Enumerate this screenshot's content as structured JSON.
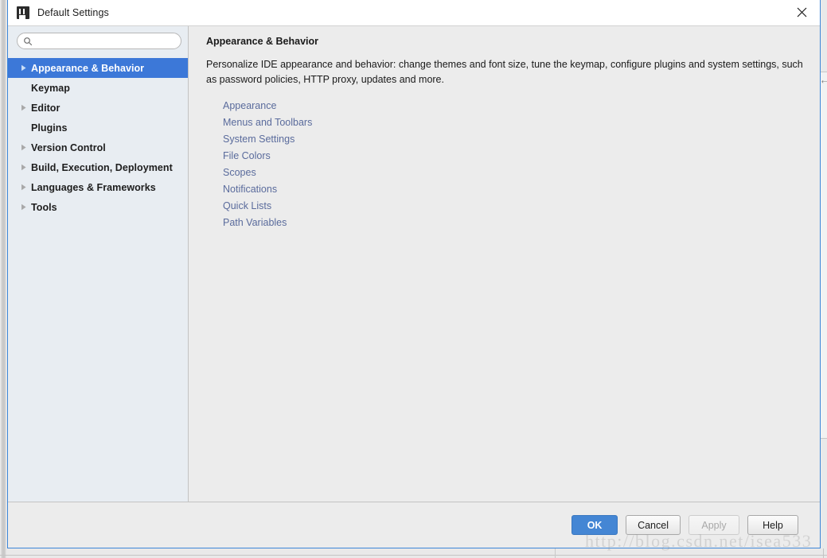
{
  "window": {
    "title": "Default Settings",
    "app_icon": "intellij-idea-icon",
    "close_icon": "close-icon"
  },
  "sidebar": {
    "search": {
      "placeholder": "",
      "value": "",
      "icon": "search-icon"
    },
    "items": [
      {
        "label": "Appearance & Behavior",
        "expandable": true,
        "selected": true
      },
      {
        "label": "Keymap",
        "expandable": false,
        "selected": false
      },
      {
        "label": "Editor",
        "expandable": true,
        "selected": false
      },
      {
        "label": "Plugins",
        "expandable": false,
        "selected": false
      },
      {
        "label": "Version Control",
        "expandable": true,
        "selected": false
      },
      {
        "label": "Build, Execution, Deployment",
        "expandable": true,
        "selected": false
      },
      {
        "label": "Languages & Frameworks",
        "expandable": true,
        "selected": false
      },
      {
        "label": "Tools",
        "expandable": true,
        "selected": false
      }
    ]
  },
  "content": {
    "title": "Appearance & Behavior",
    "description": "Personalize IDE appearance and behavior: change themes and font size, tune the keymap, configure plugins and system settings, such as password policies, HTTP proxy, updates and more.",
    "links": [
      "Appearance",
      "Menus and Toolbars",
      "System Settings",
      "File Colors",
      "Scopes",
      "Notifications",
      "Quick Lists",
      "Path Variables"
    ]
  },
  "footer": {
    "buttons": [
      {
        "label": "OK",
        "style": "primary",
        "enabled": true
      },
      {
        "label": "Cancel",
        "style": "normal",
        "enabled": true
      },
      {
        "label": "Apply",
        "style": "disabled",
        "enabled": false
      },
      {
        "label": "Help",
        "style": "normal",
        "enabled": true
      }
    ]
  },
  "watermark": {
    "text": "http://blog.csdn.net/isea533"
  },
  "colors": {
    "selection_blue": "#3c78d8",
    "primary_button": "#4486d4",
    "dialog_border": "#3c86d8",
    "sidebar_bg": "#e8edf2",
    "content_bg": "#ececec",
    "link": "#5a6b9c"
  }
}
